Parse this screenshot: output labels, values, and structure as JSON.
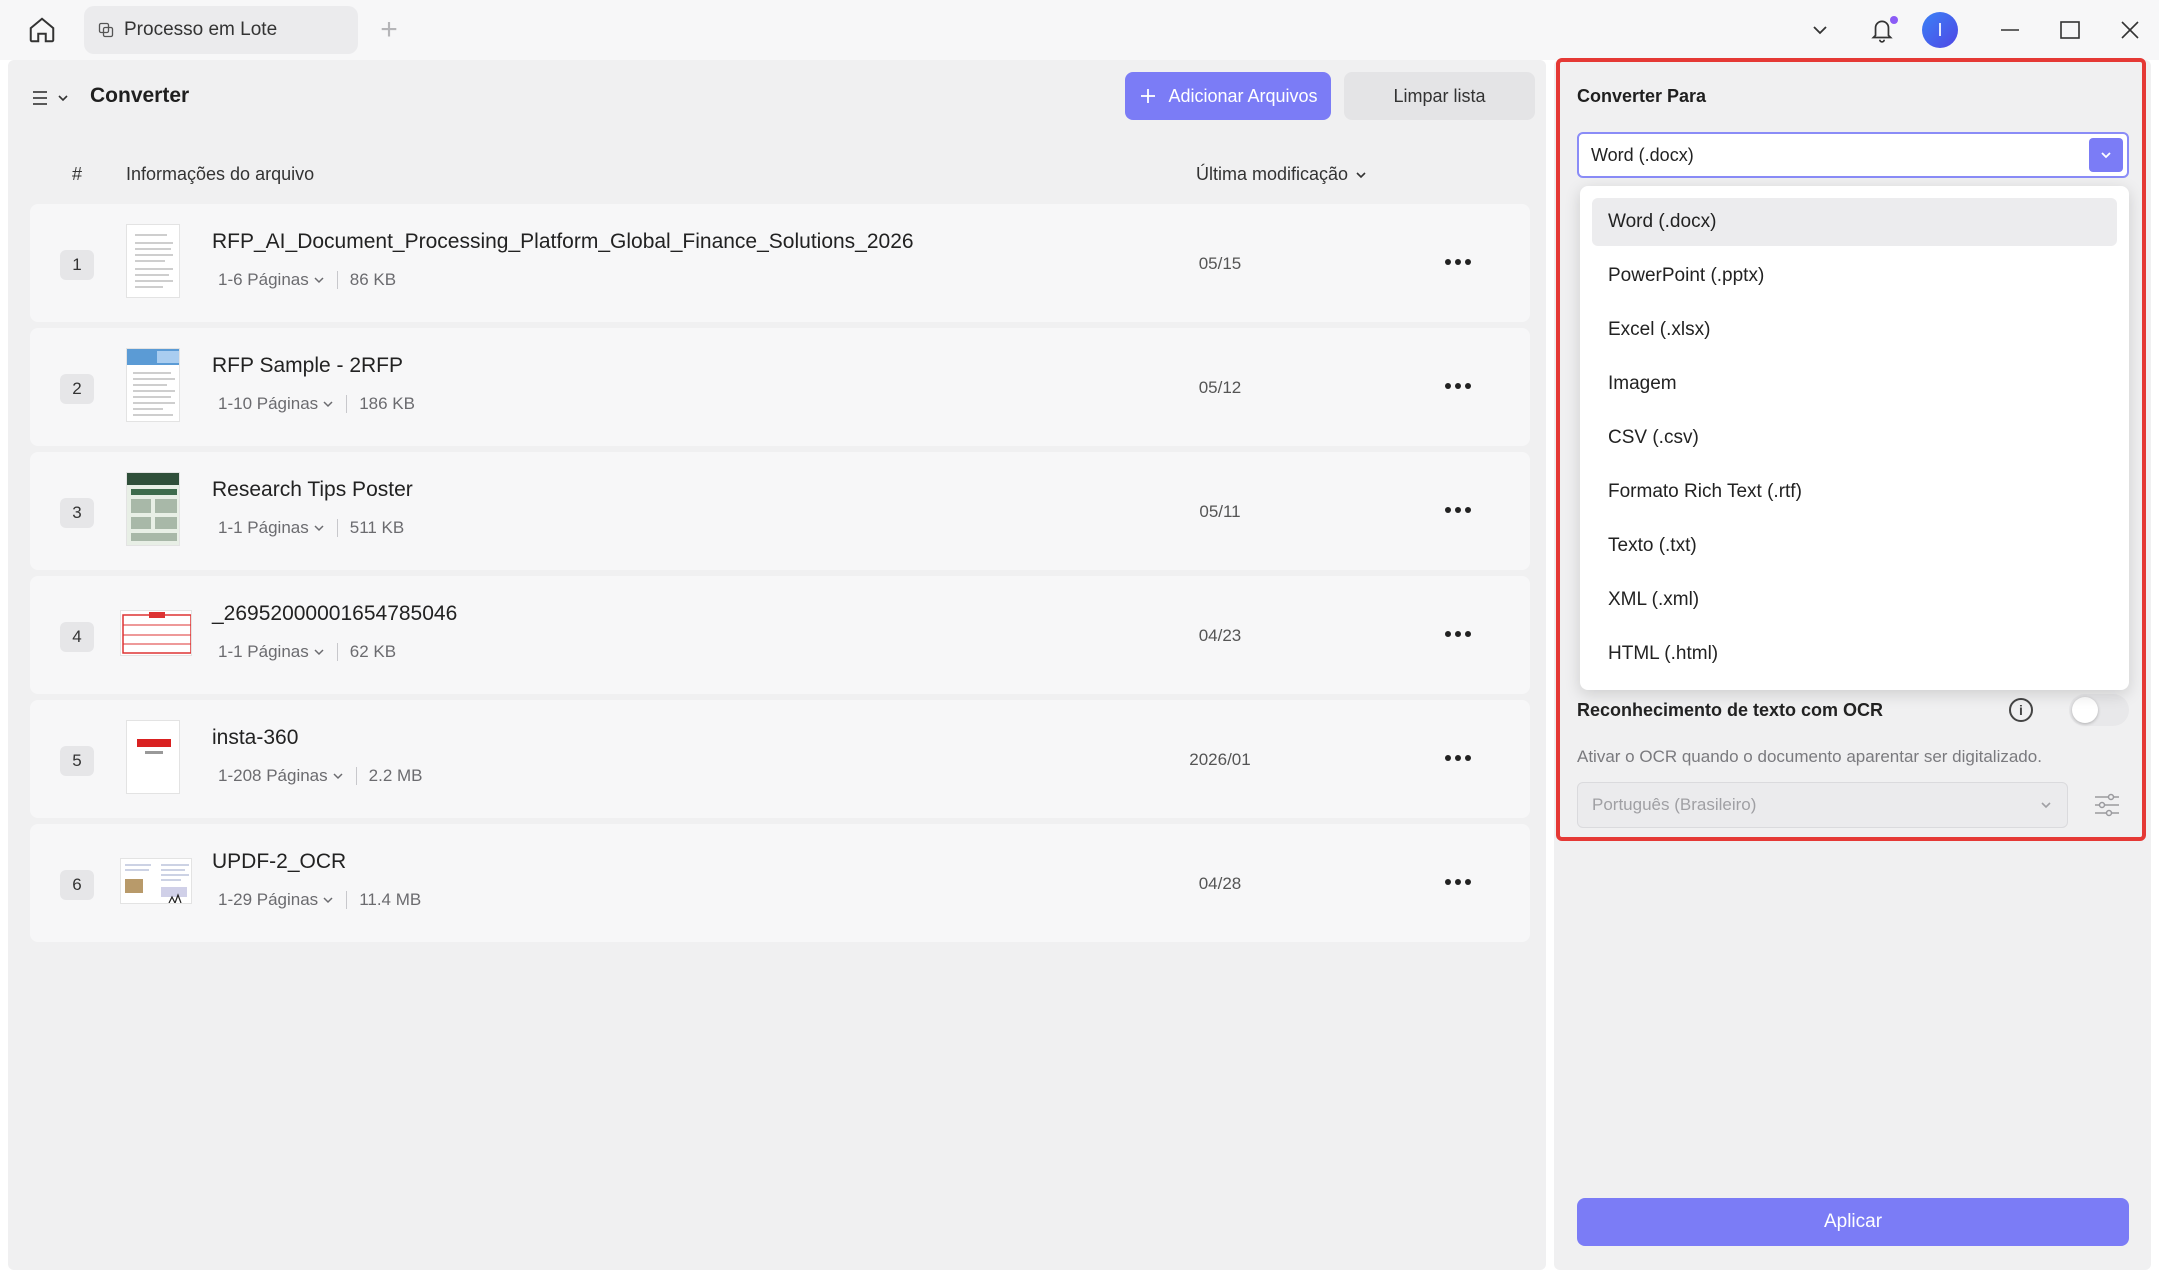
{
  "titlebar": {
    "tab_label": "Processo em Lote",
    "avatar_initial": "I"
  },
  "header": {
    "title": "Converter",
    "add_files_label": "Adicionar Arquivos",
    "clear_list_label": "Limpar lista"
  },
  "columns": {
    "index": "#",
    "file_info": "Informações do arquivo",
    "modified": "Última modificação"
  },
  "files": [
    {
      "num": "1",
      "name": "RFP_AI_Document_Processing_Platform_Global_Finance_Solutions_2026",
      "pages": "1-6 Páginas",
      "size": "86 KB",
      "date": "05/15"
    },
    {
      "num": "2",
      "name": "RFP Sample - 2RFP",
      "pages": "1-10 Páginas",
      "size": "186 KB",
      "date": "05/12"
    },
    {
      "num": "3",
      "name": "Research Tips Poster",
      "pages": "1-1 Páginas",
      "size": "511 KB",
      "date": "05/11"
    },
    {
      "num": "4",
      "name": "_26952000001654785046",
      "pages": "1-1 Páginas",
      "size": "62 KB",
      "date": "04/23"
    },
    {
      "num": "5",
      "name": "insta-360",
      "pages": "1-208 Páginas",
      "size": "2.2 MB",
      "date": "2026/01"
    },
    {
      "num": "6",
      "name": "UPDF-2_OCR",
      "pages": "1-29 Páginas",
      "size": "11.4 MB",
      "date": "04/28"
    }
  ],
  "convert": {
    "title": "Converter Para",
    "selected": "Word (.docx)",
    "options": [
      "Word (.docx)",
      "PowerPoint (.pptx)",
      "Excel (.xlsx)",
      "Imagem",
      "CSV (.csv)",
      "Formato Rich Text (.rtf)",
      "Texto (.txt)",
      "XML (.xml)",
      "HTML (.html)"
    ]
  },
  "ocr": {
    "title": "Reconhecimento de texto com OCR",
    "info_glyph": "i",
    "hint": "Ativar o OCR quando o documento aparentar ser digitalizado.",
    "language": "Português (Brasileiro)",
    "enabled": false
  },
  "apply_label": "Aplicar",
  "colors": {
    "accent": "#7b7cf6",
    "highlight_border": "#e53935",
    "panel_bg": "#f0f0f1"
  }
}
